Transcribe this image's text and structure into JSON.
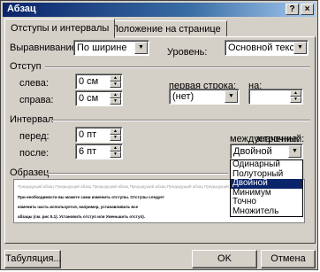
{
  "window": {
    "title": "Абзац",
    "help_label": "?",
    "close_label": "×"
  },
  "tabs": [
    {
      "label": "Отступы и интервалы",
      "active": true
    },
    {
      "label": "Положение на странице",
      "active": false
    }
  ],
  "general": {
    "alignment_label": "Выравнивание:",
    "alignment_value": "По ширине",
    "level_label": "Уровень:",
    "level_value": "Основной текст"
  },
  "indent": {
    "group_label": "Отступ",
    "left_label": "слева:",
    "left_value": "0 см",
    "right_label": "справа:",
    "right_value": "0 см",
    "first_line_label": "первая строка:",
    "first_line_value": "(нет)",
    "by_label": "на:",
    "by_value": ""
  },
  "spacing": {
    "group_label": "Интервал",
    "before_label": "перед:",
    "before_value": "0 пт",
    "after_label": "после:",
    "after_value": "6 пт",
    "line_spacing_label": "междустрочный:",
    "line_spacing_value": "Двойной",
    "at_label": "значение:",
    "at_value": "",
    "options": [
      "Одинарный",
      "Полуторный",
      "Двойной",
      "Минимум",
      "Точно",
      "Множитель"
    ],
    "selected_option": "Двойной"
  },
  "preview": {
    "group_label": "Образец",
    "grey_line": "Предыдущий абзац Предыдущий абзац Предыдущий абзац Предыдущий абзац Предыдущий абзац Предыдущий абзац Предыдущий абзац",
    "dark_lines": [
      "При необходимости вы можете сами изменить отступы. Отступы следует",
      "изменить часть используется, например, устанавливать все",
      "абзацы (см. рис 5.1). Установить отступ или Уменьшить отступ)."
    ]
  },
  "buttons": {
    "tabs": "Табуляция...",
    "ok": "OK",
    "cancel": "Отмена"
  }
}
